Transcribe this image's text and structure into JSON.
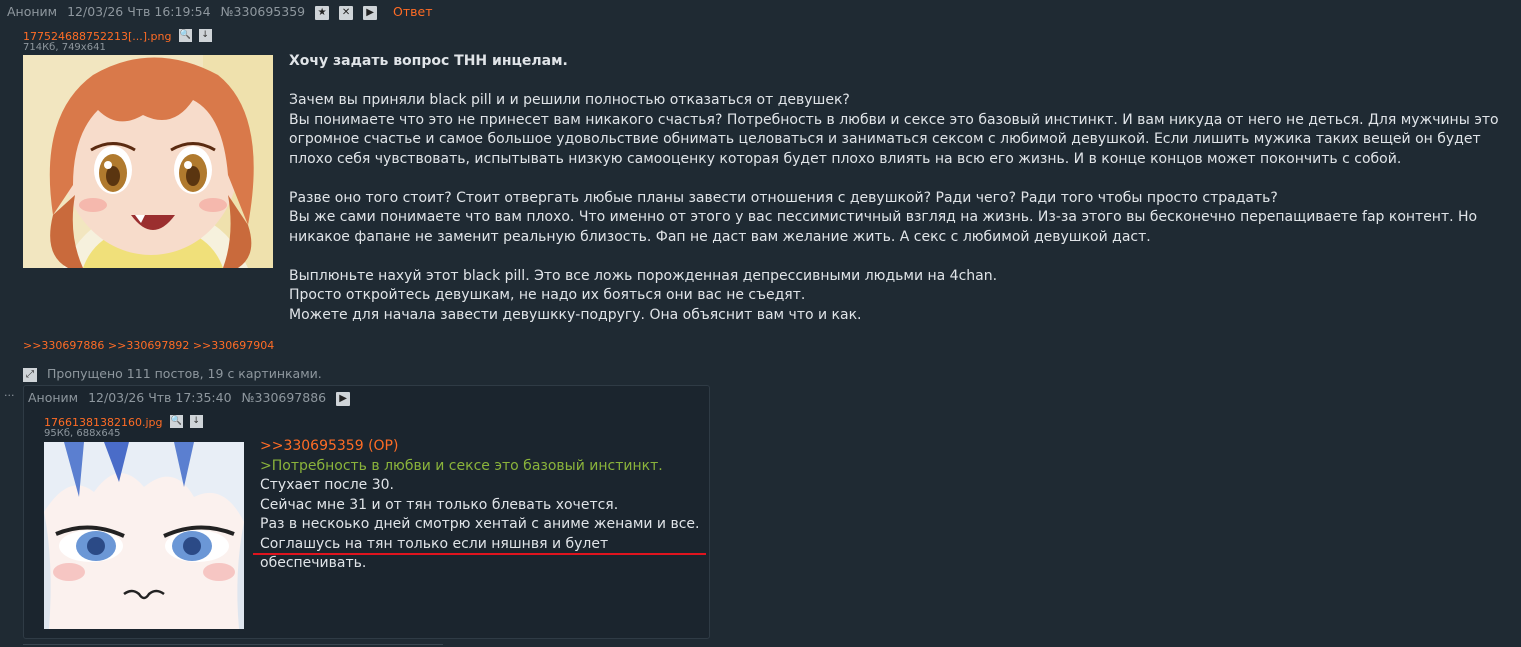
{
  "op": {
    "author": "Аноним",
    "date": "12/03/26 Чтв 16:19:54",
    "number": "№330695359",
    "reply_label": "Ответ",
    "file_name": "177524688752213[...].png",
    "file_info": "714Кб, 749x641",
    "title": "Хочу задать вопрос ТНН инцелам.",
    "paragraphs": [
      [
        "Зачем вы приняли black pill и и решили полностью отказаться от девушек?",
        "Вы понимаете что это не принесет вам никакого счастья? Потребность в любви и сексе это базовый инстинкт. И вам никуда от него не деться. Для мужчины это огромное счастье и самое большое удовольствие обнимать целоваться и заниматься сексом с любимой девушкой. Если лишить мужика таких вещей он будет плохо себя чувствовать, испытывать низкую самооценку которая будет плохо влиять на всю его жизнь. И в конце концов может покончить с собой."
      ],
      [
        "Разве оно того стоит? Стоит отвергать любые планы завести отношения с девушкой? Ради чего? Ради того чтобы просто страдать?",
        "Вы же сами понимаете что вам плохо. Что именно от этого у вас пессимистичный взгляд на жизнь. Из-за этого вы бесконечно перепащиваете fap контент. Но никакое фапане не заменит реальную близость. Фап не даст вам желание жить. А секс с любимой девушкой даст."
      ],
      [
        "Выплюньте нахуй этот black pill. Это все ложь порожденная депрессивными людьми на 4chan.",
        "Просто откройтесь девушкам, не надо их бояться они вас не съедят.",
        "Можете для начала завести девушкку-подругу. Она объяснит вам что и как."
      ]
    ],
    "replies": [
      ">>330697886",
      ">>330697892",
      ">>330697904"
    ],
    "colors": {
      "background": "#1f2a33",
      "link": "#ff6c25",
      "text": "#e0e4e8",
      "meta": "#8e979e"
    }
  },
  "skipped": "Пропущено 111 постов, 19 с картинками.",
  "reply": {
    "dots": "...",
    "author": "Аноним",
    "date": "12/03/26 Чтв 17:35:40",
    "number": "№330697886",
    "file_name": "17661381382160.jpg",
    "file_info": "95Кб, 688x645",
    "lines": {
      "ref": ">>330695359 (OP)",
      "quote": ">Потребность в любви и сексе это базовый инстинкт.",
      "l1": "Стухает после 30.",
      "l2": "Сейчас мне 31 и от тян только блевать хочется.",
      "l3": "Раз в нескоько дней смотрю хентай с аниме женами и все.",
      "l4": "Соглашусь на тян только если няшнвя и булет обеспечивать."
    },
    "underline_color": "#e0141e",
    "greentext_color": "#8ab33b"
  }
}
